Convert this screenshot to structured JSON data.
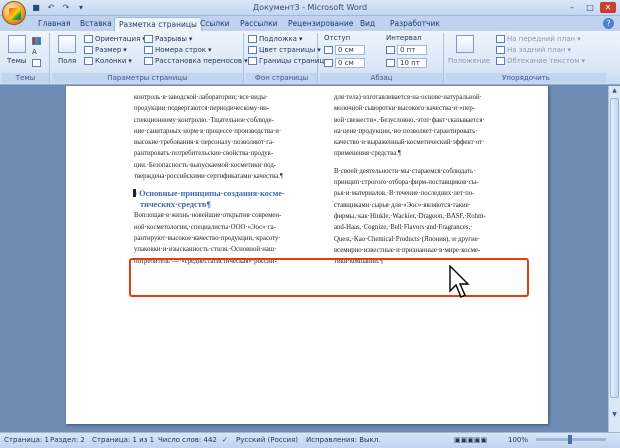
{
  "window": {
    "title": "Документ3 - Microsoft Word"
  },
  "tabs": [
    "Главная",
    "Вставка",
    "Разметка страницы",
    "Ссылки",
    "Рассылки",
    "Рецензирование",
    "Вид",
    "Разработчик"
  ],
  "ribbon": {
    "themes": {
      "button": "Темы",
      "label": "Темы"
    },
    "page_setup": {
      "fields": "Поля",
      "orientation": "Ориентация",
      "size": "Размер",
      "columns": "Колонки",
      "breaks": "Разрывы",
      "line_numbers": "Номера строк",
      "hyphenation": "Расстановка переносов",
      "label": "Параметры страницы"
    },
    "background": {
      "watermark": "Подложка",
      "page_color": "Цвет страницы",
      "page_borders": "Границы страниц",
      "label": "Фон страницы"
    },
    "paragraph": {
      "indent": "Отступ",
      "spacing": "Интервал",
      "indent_left": "0 см",
      "indent_right": "0 см",
      "spacing_before": "0 пт",
      "spacing_after": "10 пт",
      "label": "Абзац"
    },
    "arrange": {
      "position": "Положение",
      "bring_front": "На передний план",
      "send_back": "На задний план",
      "text_wrap": "Обтекание текстом",
      "label": "Упорядочить"
    }
  },
  "document": {
    "left_col": {
      "top_lines": [
        "контроль·в·заводской·лабора­тории;·все·виды·",
        "продукции·подвергаются·периодическому·ин-",
        "спекционному·контролю.·Тщательное·соблюде-",
        "ние·санитарных·норм·в·процессе·производства·и·",
        "высокие·требования·к·персоналу·позволяют·га-",
        "рантировать·потребительские·свойства·продук-",
        "ции.·Безопасность·выпускаемой·косметики·под-",
        "тверждена·российскими·сертификатами·качества.¶"
      ],
      "heading_line1": "Основные·принципы·создания·косме-",
      "heading_line2": "тических·средств¶",
      "body_lines": [
        "Воплощая·в·жизнь·новейшие·открытия·современ-",
        "ной·косметологии,·специалисты·ООО·«Эос»·га-",
        "рантируют·высокое·качество·продукции,·красоту·",
        "упаковки·и·изысканность·стиля.·Основной·наш·",
        "потребитель·—·«среднестатистическая»·россий-"
      ]
    },
    "right_col": {
      "top_lines": [
        "для·тела)·изготавливается·на·основе·натуральной·",
        "молочной·сыворотки·высокого·качества·и·«пер-",
        "вой·свежести».·Безусловно,·этот·факт·сказывается·",
        "на·цене·продукции,·но·позволяет·гарантировать·",
        "качество·и·выраженный·косметический·эффект·от·",
        "применения·средства.¶"
      ],
      "para2_lines": [
        "В·своей·деятельности·мы·стараемся·соблюдать·",
        "принцип·строгого·отбора·фирм-поставщиков·сы-",
        "рья·и·материалов.·В·течение·последних·лет·по-",
        "ставщиками·сырья·для·«Эос»·являются·такие·",
        "фирмы,·как·Hinkle,·Wackier,·Dragoon,·BASF,·Rohm-",
        "and-Haas,·Cognize,·Bell·Flavors·and·Fragrances,·",
        "Quest,·Kao·Chemical·Products·(Япония),·и·другие·",
        "всемирно·известные·и·признанные·в·мире·косме-",
        "тики·компании.¶"
      ]
    }
  },
  "status": {
    "page": "Страница: 1",
    "section": "Раздел: 2",
    "pages": "Страница: 1 из 1",
    "words": "Число слов: 442",
    "language": "Русский (Россия)",
    "track_changes": "Исправления: Выкл.",
    "zoom": "100%"
  },
  "colors": {
    "accent": "#3b6db0",
    "highlight_box": "#e04010"
  }
}
